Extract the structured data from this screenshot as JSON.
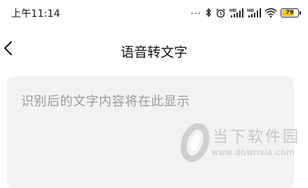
{
  "status_bar": {
    "time": "上午11:14",
    "dots": "...",
    "battery_level": "79",
    "battery_color": "#f4c41d",
    "icons": [
      "bluetooth-icon",
      "alarm-icon",
      "hd-signal-icon",
      "hd-signal-icon",
      "wifi-icon",
      "battery-icon"
    ]
  },
  "nav": {
    "back_icon": "chevron-left-icon",
    "title": "语音转文字"
  },
  "content": {
    "placeholder": "识别后的文字内容将在此显示"
  },
  "watermark": {
    "name": "当下软件园",
    "url": "www.downxia.com"
  }
}
